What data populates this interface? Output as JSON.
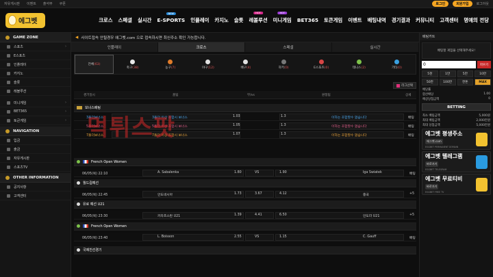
{
  "topbar": {
    "links": [
      "자유게시판",
      "이벤트",
      "출석부",
      "쿠폰"
    ],
    "login": "로그인",
    "join": "회원가입",
    "logout": "로그아웃"
  },
  "logo": {
    "text": "에그벳"
  },
  "nav": [
    {
      "label": "크로스",
      "badge": ""
    },
    {
      "label": "스페셜",
      "badge": ""
    },
    {
      "label": "실시간",
      "badge": ""
    },
    {
      "label": "E-SPORTS",
      "badge": "NEW"
    },
    {
      "label": "인플레이",
      "badge": ""
    },
    {
      "label": "카지노",
      "badge": ""
    },
    {
      "label": "슬롯",
      "badge": ""
    },
    {
      "label": "레볼루션",
      "badge": "HOT"
    },
    {
      "label": "미니게임",
      "badge": "HOT"
    },
    {
      "label": "BET365",
      "badge": ""
    },
    {
      "label": "토큰게임",
      "badge": ""
    },
    {
      "label": "이벤트",
      "badge": ""
    },
    {
      "label": "배팅내역",
      "badge": ""
    },
    {
      "label": "경기결과",
      "badge": ""
    },
    {
      "label": "커뮤니티",
      "badge": ""
    },
    {
      "label": "고객센터",
      "badge": ""
    },
    {
      "label": "명예의 전당",
      "badge": ""
    }
  ],
  "sidebar": {
    "game_zone": "GAME ZONE",
    "game_items": [
      "스포츠",
      "E스포츠",
      "인플레이",
      "카지노",
      "슬롯",
      "레볼루션"
    ],
    "minigame": "미니게임",
    "bet365": "BET365",
    "token": "토큰게임",
    "navigation": "NAVIGATION",
    "nav_items": [
      "입금",
      "출금",
      "자유게시판",
      "스포츠TV"
    ],
    "other": "OTHER INFORMATION",
    "other_items": [
      "공지사항",
      "고객센터"
    ]
  },
  "notice": "사이트접속 안될경우 에그벳.com 으로 접속하시면 최신주소 확인 가능합니다.",
  "tabs": [
    "인플레이",
    "크로스",
    "스페셜",
    "실시간"
  ],
  "sports": [
    {
      "name": "전체",
      "count": "(63)"
    },
    {
      "name": "축구",
      "count": "(38)"
    },
    {
      "name": "농구",
      "count": "(7)"
    },
    {
      "name": "야구",
      "count": "(12)"
    },
    {
      "name": "배구",
      "count": "(4)"
    },
    {
      "name": "하키",
      "count": "(0)"
    },
    {
      "name": "E스포츠",
      "count": "(0)"
    },
    {
      "name": "테니스",
      "count": "(2)"
    },
    {
      "name": "기타",
      "count": "(0)"
    }
  ],
  "league_btn": "리그선택",
  "columns": {
    "time": "경기일시",
    "home": "홈팀",
    "vs": "무/vs",
    "away": "원정팀",
    "detail": "상세"
  },
  "bonus": {
    "title": "보너스배팅",
    "rows": [
      {
        "name": "3폴더보너스",
        "home": "3폴더 이상 조합시 보너스",
        "odd": "1.03",
        "away_odd": "1.3",
        "away": "이하는 조합할수 없습니다",
        "detail": "배팅"
      },
      {
        "name": "5폴더보너스",
        "home": "5폴더 이상 조합시 보너스",
        "odd": "1.05",
        "away_odd": "1.3",
        "away": "이하는 조합할수 없습니다",
        "detail": "배팅"
      },
      {
        "name": "7폴더보너스",
        "home": "7폴더 이상 조합시 보너스",
        "odd": "1.07",
        "away_odd": "1.3",
        "away": "이하는 조합할수 없습니다",
        "detail": "배팅"
      }
    ]
  },
  "matches": [
    {
      "league": "French Open Women",
      "time": "06/05(목) 22:10",
      "home": "A. Sabalenka",
      "hodd": "1.80",
      "draw": "VS",
      "aodd": "1.90",
      "away": "Iga Swiatek",
      "detail": "배팅"
    },
    {
      "league": "월드컵예선",
      "time": "06/05(목) 22:45",
      "home": "안도네시아",
      "hodd": "1.73",
      "draw": "3.67",
      "aodd": "4.12",
      "away": "중국",
      "detail": "+5"
    },
    {
      "league": "유로 예선 U21",
      "time": "06/05(목) 23:30",
      "home": "카자흐스탄 U21",
      "hodd": "1.39",
      "draw": "4.41",
      "aodd": "6.50",
      "away": "안도라 U21",
      "detail": "+5"
    },
    {
      "league": "French Open Women",
      "time": "06/05(목) 23:40",
      "home": "L. Boisson",
      "hodd": "2.55",
      "draw": "VS",
      "aodd": "1.15",
      "away": "C. Gauff",
      "detail": "배팅"
    }
  ],
  "last_section": "국제친선경기",
  "watermark": "먹튀스팟",
  "slip": {
    "title": "배팅카트",
    "empty": "배팅할 게임을 선택해주세요!",
    "amount": "0",
    "reset": "지우기",
    "buttons": [
      "5천",
      "1만",
      "5만",
      "10만",
      "50만",
      "100만",
      "잔돈",
      "MAX"
    ],
    "labels": [
      {
        "k": "배당률",
        "v": ""
      },
      {
        "k": "합산배당",
        "v": "1.00"
      },
      {
        "k": "예상당첨금액",
        "v": "0"
      }
    ],
    "bet": "BETTING",
    "limits": [
      {
        "k": "최소 배팅금액",
        "v": "5,000원"
      },
      {
        "k": "최대 배팅금액",
        "v": "2,000만원"
      },
      {
        "k": "최대 당첨금액",
        "v": "5,000만원"
      }
    ]
  },
  "banners": [
    {
      "big": "에그벳 평생주소",
      "sub": "에그벳.com",
      "tiny": "EGGBET PERMANENT DOMAIN"
    },
    {
      "big": "에그벳 텔레그램",
      "sub": "바로가기",
      "tiny": "EGGBET TELEGRAM"
    },
    {
      "big": "에그벳 무료티비",
      "sub": "바로가기",
      "tiny": "EGGBET FREE TV"
    }
  ],
  "colors": {
    "accent": "#f5a623",
    "brand": "#f2c230",
    "bet_red": "#c62828"
  }
}
